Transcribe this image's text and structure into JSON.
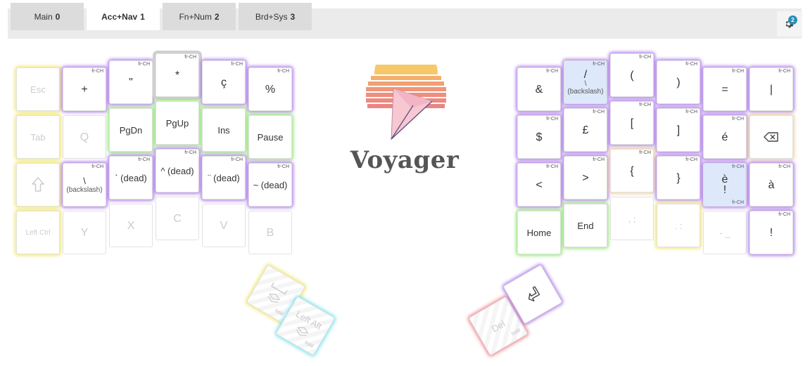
{
  "tabs": [
    {
      "label": "Main",
      "num": "0"
    },
    {
      "label": "Acc+Nav",
      "num": "1"
    },
    {
      "label": "Fn+Num",
      "num": "2"
    },
    {
      "label": "Brd+Sys",
      "num": "3"
    }
  ],
  "active_tab": "Acc+Nav 1",
  "settings": {
    "badge": "2"
  },
  "layout_tag": "fr-CH",
  "logo_text": "Voyager",
  "colors": {
    "purple": "#a56ee6",
    "yellow": "#eee464",
    "green": "#8ce16e",
    "cyan": "#6ee1eb",
    "red": "#f07882",
    "orange": "#ebcd96",
    "highlight_blue": "#dde8fb"
  },
  "left": {
    "esc": "Esc",
    "plus": "+",
    "dquote": "\"",
    "star": "*",
    "ccedil": "ç",
    "percent": "%",
    "tab": "Tab",
    "q": "Q",
    "pgdn": "PgDn",
    "pgup": "PgUp",
    "ins": "Ins",
    "pause": "Pause",
    "shift_icon": "shift-icon",
    "backslash": "\\",
    "backslash_sub": "(backslash)",
    "grave": "` (dead)",
    "circ": "^ (dead)",
    "diaer": "¨ (dead)",
    "tilde": "~ (dead)",
    "ctrl": "Left Ctrl",
    "y": "Y",
    "x": "X",
    "c": "C",
    "v": "V",
    "b": "B",
    "thumb1_hold": "hold",
    "thumb2_label": "Left Alt",
    "thumb2_hold": "hold"
  },
  "right": {
    "amp": "&",
    "slash": "/",
    "slash_sub": "\\",
    "slash_sub2": "(backslash)",
    "lparen": "(",
    "rparen": ")",
    "equal": "=",
    "pipe": "|",
    "dollar": "$",
    "pound": "£",
    "lbracket": "[",
    "rbracket": "]",
    "eacute": "é",
    "backspace_icon": "backspace-icon",
    "lt": "<",
    "gt": ">",
    "lbrace": "{",
    "rbrace": "}",
    "egrave": "è",
    "excl_shift": "!",
    "agrave": "à",
    "home": "Home",
    "end": "End",
    "comma": ", ;",
    "period": ". :",
    "dash": "- _",
    "excl": "!",
    "del": "Del",
    "del_hold": "hold",
    "enter_icon": "enter-icon"
  }
}
